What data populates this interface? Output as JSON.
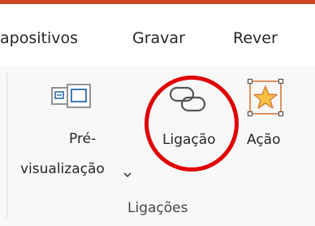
{
  "tabs": {
    "slides_label": "apositivos",
    "record_label": "Gravar",
    "review_label": "Rever"
  },
  "ribbon": {
    "preview": {
      "label_line1": "Pré-",
      "label_line2": "visualização",
      "icon": "preview-icon",
      "dropdown_icon": "chevron-down-icon"
    },
    "link": {
      "label": "Ligação",
      "icon": "link-icon"
    },
    "action": {
      "label": "Ação",
      "icon": "star-icon"
    },
    "group_label": "Ligações"
  },
  "highlight": {
    "description": "red circle annotation around Ligação",
    "color": "#e00000"
  },
  "colors": {
    "accent_orange": "#d04423",
    "annotation_red": "#e00000",
    "icon_blue": "#2b6cb0",
    "star_fill": "#f5c242",
    "star_frame": "#d97a3a"
  }
}
